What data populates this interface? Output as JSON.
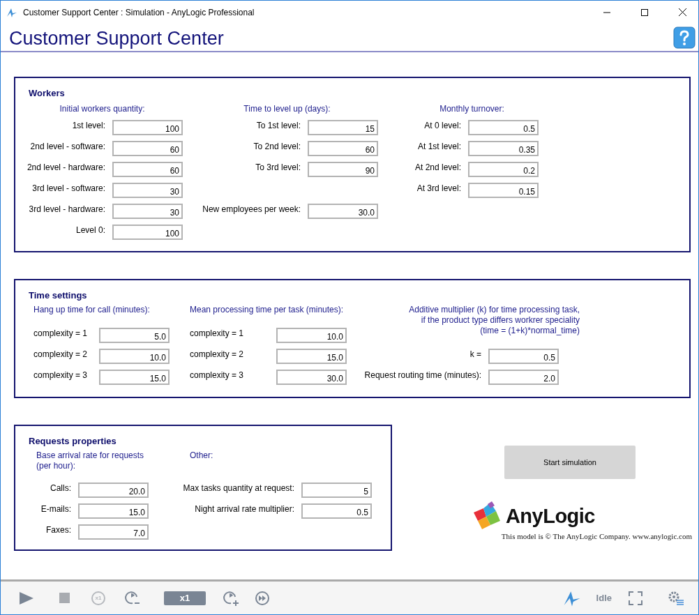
{
  "window": {
    "title": "Customer Support Center : Simulation - AnyLogic Professional"
  },
  "header": {
    "title": "Customer Support Center"
  },
  "workers": {
    "title": "Workers",
    "columns": [
      {
        "heading": "Initial workers quantity:",
        "fields": [
          {
            "label": "1st level:",
            "value": "100"
          },
          {
            "label": "2nd level - software:",
            "value": "60"
          },
          {
            "label": "2nd level - hardware:",
            "value": "60"
          },
          {
            "label": "3rd level - software:",
            "value": "30"
          },
          {
            "label": "3rd level - hardware:",
            "value": "30"
          },
          {
            "label": "Level 0:",
            "value": "100"
          }
        ]
      },
      {
        "heading": "Time to level up (days):",
        "fields": [
          {
            "label": "To 1st level:",
            "value": "15"
          },
          {
            "label": "To 2nd level:",
            "value": "60"
          },
          {
            "label": "To 3rd level:",
            "value": "90"
          }
        ]
      },
      {
        "heading": "Monthly turnover:",
        "fields": [
          {
            "label": "At 0 level:",
            "value": "0.5"
          },
          {
            "label": "At 1st level:",
            "value": "0.35"
          },
          {
            "label": "At 2nd level:",
            "value": "0.2"
          },
          {
            "label": "At 3rd level:",
            "value": "0.15"
          }
        ]
      }
    ],
    "new_employees": {
      "label": "New employees per week:",
      "value": "30.0"
    }
  },
  "time_settings": {
    "title": "Time settings",
    "columns": [
      {
        "heading": "Hang up time for call (minutes):",
        "fields": [
          {
            "label": "complexity = 1",
            "value": "5.0"
          },
          {
            "label": "complexity = 2",
            "value": "10.0"
          },
          {
            "label": "complexity = 3",
            "value": "15.0"
          }
        ]
      },
      {
        "heading": "Mean processing time per task (minutes):",
        "fields": [
          {
            "label": "complexity = 1",
            "value": "10.0"
          },
          {
            "label": "complexity = 2",
            "value": "15.0"
          },
          {
            "label": "complexity = 3",
            "value": "30.0"
          }
        ]
      }
    ],
    "multiplier": {
      "heading": [
        "Additive multiplier (k) for time processing task,",
        "if the product type differs workrer speciality",
        "(time = (1+k)*normal_time)"
      ],
      "fields": [
        {
          "label": "k =",
          "value": "0.5"
        },
        {
          "label": "Request routing time (minutes):",
          "value": "2.0"
        }
      ]
    }
  },
  "requests": {
    "title": "Requests properties",
    "columns": [
      {
        "heading": "Base arrival rate for requests (per hour):",
        "fields": [
          {
            "label": "Calls:",
            "value": "20.0"
          },
          {
            "label": "E-mails:",
            "value": "15.0"
          },
          {
            "label": "Faxes:",
            "value": "7.0"
          }
        ]
      },
      {
        "heading": "Other:",
        "fields": [
          {
            "label": "Max tasks quantity at request:",
            "value": "5"
          },
          {
            "label": "Night arrival rate multiplier:",
            "value": "0.5"
          }
        ]
      }
    ]
  },
  "start_button": "Start simulation",
  "logo": {
    "name": "AnyLogic",
    "copyright": "This model is © The AnyLogic Company. www.anylogic.com"
  },
  "toolbar": {
    "speed_reset": "x1",
    "speed": "x1",
    "status": "Idle"
  }
}
